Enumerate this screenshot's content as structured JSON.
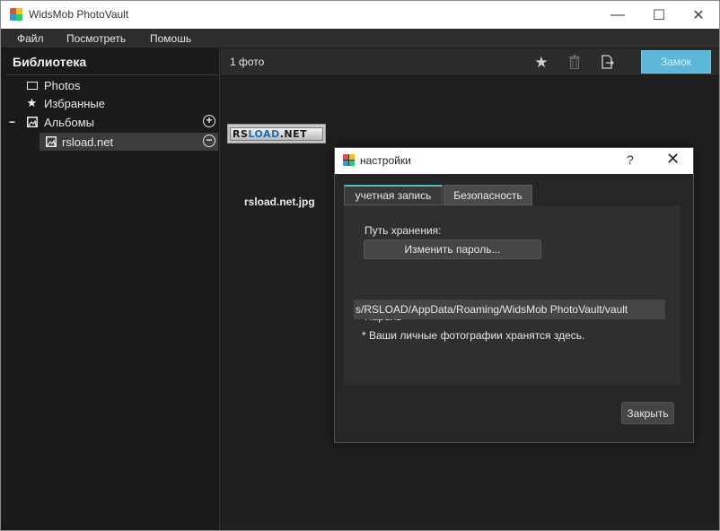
{
  "window": {
    "title": "WidsMob PhotoVault",
    "minimize_glyph": "—",
    "maximize_glyph": "☐",
    "close_glyph": "✕"
  },
  "menu": {
    "items": [
      "Файл",
      "Посмотреть",
      "Помошь"
    ]
  },
  "sidebar": {
    "title": "Библиотека",
    "items": [
      {
        "label": "Photos",
        "icon": "frame-icon"
      },
      {
        "label": "Избранные",
        "icon": "star-icon"
      },
      {
        "label": "Альбомы",
        "icon": "album-icon",
        "expand_glyph": "−",
        "action_glyph": "+"
      },
      {
        "label": "rsload.net",
        "icon": "image-icon",
        "action_glyph": "−",
        "selected": true
      }
    ]
  },
  "toolbar": {
    "count": "1 фото",
    "lock_label": "Замок"
  },
  "gallery": {
    "thumb_text_dark": "RS",
    "thumb_text_blue": "LOAD",
    "thumb_text_dark2": ".NET",
    "caption": "rsload.net.jpg"
  },
  "dialog": {
    "title": "настройки",
    "help": "?",
    "close": "✕",
    "tabs": [
      "учетная запись",
      "Безопасность"
    ],
    "storage_label": "Путь хранения:",
    "change_password_button": "Изменить пароль...",
    "password_label": "Пароль",
    "path_value": "s/RSLOAD/AppData/Roaming/WidsMob PhotoVault/vault",
    "note": "* Ваши личные фотографии хранятся здесь.",
    "close_button": "Закрыть"
  },
  "colors": {
    "accent": "#5cb8d6",
    "tab_accent": "#4ec1b0"
  }
}
